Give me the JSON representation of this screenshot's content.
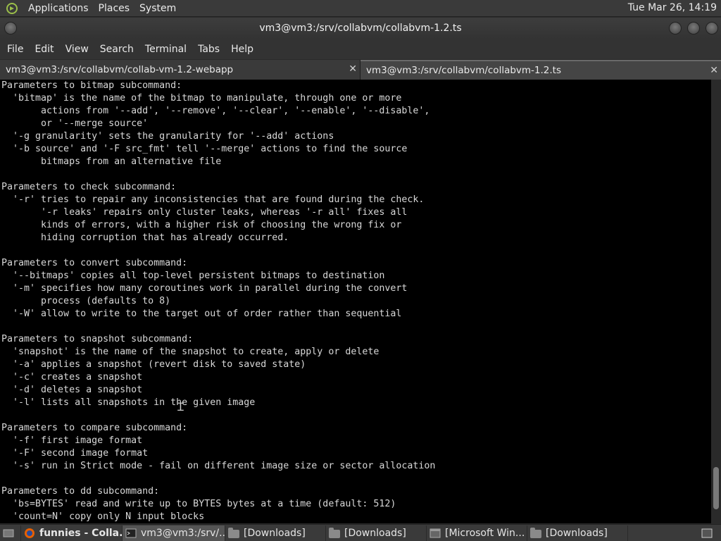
{
  "top_panel": {
    "menus": [
      "Applications",
      "Places",
      "System"
    ],
    "clock": "Tue Mar 26, 14:19"
  },
  "window": {
    "title": "vm3@vm3:/srv/collabvm/collabvm-1.2.ts"
  },
  "menubar": [
    "File",
    "Edit",
    "View",
    "Search",
    "Terminal",
    "Tabs",
    "Help"
  ],
  "tabs": [
    {
      "label": "vm3@vm3:/srv/collabvm/collab-vm-1.2-webapp",
      "close": "✕"
    },
    {
      "label": "vm3@vm3:/srv/collabvm/collabvm-1.2.ts",
      "close": "✕"
    }
  ],
  "terminal": {
    "lines": [
      "Parameters to bitmap subcommand:",
      "  'bitmap' is the name of the bitmap to manipulate, through one or more",
      "       actions from '--add', '--remove', '--clear', '--enable', '--disable',",
      "       or '--merge source'",
      "  '-g granularity' sets the granularity for '--add' actions",
      "  '-b source' and '-F src_fmt' tell '--merge' actions to find the source",
      "       bitmaps from an alternative file",
      "",
      "Parameters to check subcommand:",
      "  '-r' tries to repair any inconsistencies that are found during the check.",
      "       '-r leaks' repairs only cluster leaks, whereas '-r all' fixes all",
      "       kinds of errors, with a higher risk of choosing the wrong fix or",
      "       hiding corruption that has already occurred.",
      "",
      "Parameters to convert subcommand:",
      "  '--bitmaps' copies all top-level persistent bitmaps to destination",
      "  '-m' specifies how many coroutines work in parallel during the convert",
      "       process (defaults to 8)",
      "  '-W' allow to write to the target out of order rather than sequential",
      "",
      "Parameters to snapshot subcommand:",
      "  'snapshot' is the name of the snapshot to create, apply or delete",
      "  '-a' applies a snapshot (revert disk to saved state)",
      "  '-c' creates a snapshot",
      "  '-d' deletes a snapshot",
      "  '-l' lists all snapshots in the given image",
      "",
      "Parameters to compare subcommand:",
      "  '-f' first image format",
      "  '-F' second image format",
      "  '-s' run in Strict mode - fail on different image size or sector allocation",
      "",
      "Parameters to dd subcommand:",
      "  'bs=BYTES' read and write up to BYTES bytes at a time (default: 512)",
      "  'count=N' copy only N input blocks"
    ]
  },
  "taskbar": {
    "items": [
      {
        "label": "",
        "icon": "show-desktop-icon"
      },
      {
        "label": "funnies - Colla...",
        "icon": "firefox-icon"
      },
      {
        "label": "vm3@vm3:/srv/...",
        "icon": "terminal-icon",
        "active": true
      },
      {
        "label": "[Downloads]",
        "icon": "folder-icon"
      },
      {
        "label": "[Downloads]",
        "icon": "folder-icon"
      },
      {
        "label": "[Microsoft Win...",
        "icon": "window-icon"
      },
      {
        "label": "[Downloads]",
        "icon": "folder-icon"
      },
      {
        "label": "",
        "icon": "workspace-switcher-icon"
      }
    ]
  },
  "colors": {
    "terminal_bg": "#000000",
    "terminal_fg": "#d8d8d8",
    "panel_bg": "#3a3a3a"
  }
}
